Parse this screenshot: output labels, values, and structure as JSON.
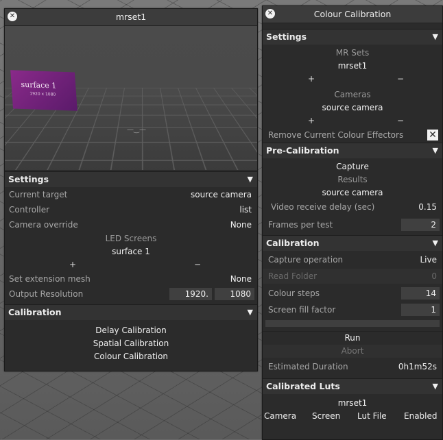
{
  "left_panel": {
    "title": "mrset1",
    "close_icon": "close-icon",
    "viewport": {
      "logo_text": "surface 1",
      "logo_sub": "1920 x 1080"
    },
    "settings": {
      "header": "Settings",
      "current_target_label": "Current target",
      "current_target_value": "source camera",
      "controller_label": "Controller",
      "controller_value": "list",
      "camera_override_label": "Camera override",
      "camera_override_value": "None",
      "led_screens_label": "LED Screens",
      "led_screen_item": "surface 1",
      "plus": "+",
      "minus": "−",
      "set_extension_mesh_label": "Set extension mesh",
      "set_extension_mesh_value": "None",
      "output_resolution_label": "Output Resolution",
      "output_res_w": "1920.",
      "output_res_h": "1080"
    },
    "calibration": {
      "header": "Calibration",
      "items": [
        "Delay Calibration",
        "Spatial Calibration",
        "Colour Calibration"
      ]
    }
  },
  "right_panel": {
    "title": "Colour Calibration",
    "close_icon": "close-icon",
    "settings": {
      "header": "Settings",
      "mr_sets_label": "MR Sets",
      "mr_set_item": "mrset1",
      "plus": "+",
      "minus": "−",
      "cameras_label": "Cameras",
      "camera_item": "source camera",
      "remove_effectors_label": "Remove Current Colour Effectors",
      "remove_effectors_checked": "✕"
    },
    "precalibration": {
      "header": "Pre-Calibration",
      "capture": "Capture",
      "results": "Results",
      "results_item": "source camera",
      "video_delay_label": "Video receive delay (sec)",
      "video_delay_value": "0.15",
      "frames_label": "Frames per test",
      "frames_value": "2"
    },
    "calibration": {
      "header": "Calibration",
      "capture_op_label": "Capture operation",
      "capture_op_value": "Live",
      "read_folder_label": "Read Folder",
      "read_folder_value": "0",
      "colour_steps_label": "Colour steps",
      "colour_steps_value": "14",
      "fill_factor_label": "Screen fill factor",
      "fill_factor_value": "1",
      "run": "Run",
      "abort": "Abort",
      "duration_label": "Estimated Duration",
      "duration_value": "0h1m52s"
    },
    "luts": {
      "header": "Calibrated Luts",
      "set_name": "mrset1",
      "columns": [
        "Camera",
        "Screen",
        "Lut File",
        "Enabled"
      ]
    }
  },
  "triangle_icon": "▼"
}
